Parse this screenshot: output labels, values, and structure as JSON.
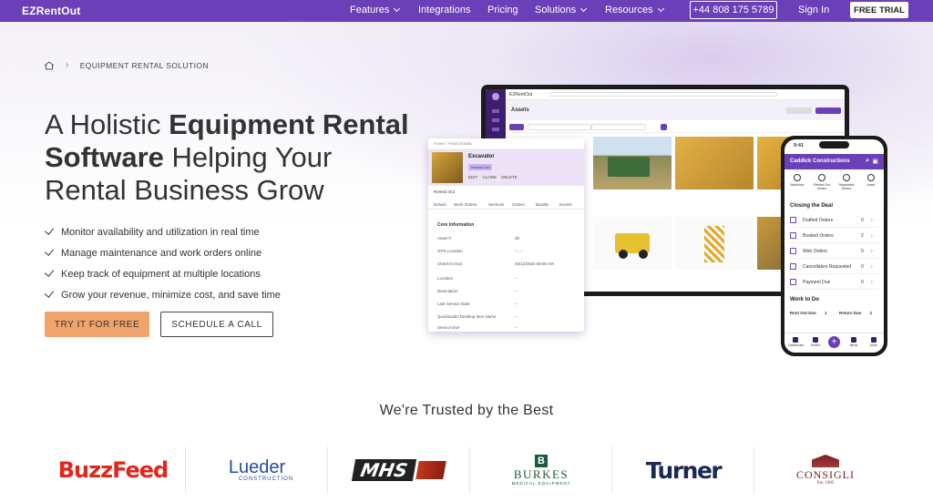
{
  "nav": {
    "brand": "EZRentOut",
    "items": [
      {
        "label": "Features",
        "dropdown": true
      },
      {
        "label": "Integrations",
        "dropdown": false
      },
      {
        "label": "Pricing",
        "dropdown": false
      },
      {
        "label": "Solutions",
        "dropdown": true
      },
      {
        "label": "Resources",
        "dropdown": true
      }
    ],
    "phone": "+44 808 175 5789",
    "signin": "Sign In",
    "trial": "FREE TRIAL"
  },
  "breadcrumb": {
    "current": "EQUIPMENT RENTAL SOLUTION"
  },
  "hero": {
    "title_parts": [
      "A Holistic ",
      "Equipment Rental Software",
      " Helping Your Rental Business Grow"
    ],
    "bullets": [
      "Monitor availability and utilization in real time",
      "Manage maintenance and work orders online",
      "Keep track of equipment at multiple locations",
      "Grow your revenue, minimize cost, and save time"
    ],
    "cta_primary": "TRY IT FOR FREE",
    "cta_secondary": "SCHEDULE A CALL"
  },
  "laptop": {
    "app_name": "EZRentOut",
    "page_title": "Assets"
  },
  "detail_card": {
    "breadcrumb": "Home / Asset Details",
    "title": "Excavator",
    "badge": "Rented Out",
    "actions": [
      "EDIT",
      "CLONE",
      "DELETE"
    ],
    "rented_line": "Rented Out",
    "tabs": [
      "Details",
      "Work Orders",
      "Services",
      "Orders",
      "Bundle",
      "Events"
    ],
    "section": "Core Information",
    "rows": [
      {
        "label": "Asset #",
        "value": "35"
      },
      {
        "label": "GPS Location",
        "value": "--, --"
      },
      {
        "label": "Check-In Due",
        "value": "03/12/2024   09:00 AM"
      },
      {
        "label": "Location",
        "value": "--"
      },
      {
        "label": "Description",
        "value": "--"
      },
      {
        "label": "Last Service Date",
        "value": "--"
      },
      {
        "label": "Quickbooks Desktop Item Name",
        "value": "--"
      },
      {
        "label": "Service Due",
        "value": "--"
      }
    ]
  },
  "phone": {
    "time": "9:41",
    "company": "Caddick Constructions",
    "quick_icons": [
      "Machines",
      "Rented Out Orders",
      "Requested Orders",
      "Asset"
    ],
    "section1": "Closing the Deal",
    "rows": [
      {
        "label": "Drafted Orders",
        "count": "0"
      },
      {
        "label": "Booked Orders",
        "count": "2"
      },
      {
        "label": "Web Orders",
        "count": "0"
      },
      {
        "label": "Cancellation Requested",
        "count": "0"
      },
      {
        "label": "Payment Due",
        "count": "0"
      }
    ],
    "section2": "Work to Do",
    "work": [
      {
        "label": "Rent Out Due",
        "count": "1"
      },
      {
        "label": "Return Due",
        "count": "2"
      }
    ],
    "bottom_nav": [
      "Dashboard",
      "Orders",
      "Items",
      "More"
    ]
  },
  "trusted": {
    "heading": "We're Trusted by the Best",
    "logos": [
      {
        "name": "BuzzFeed",
        "color": "#e32619"
      },
      {
        "name": "Lueder",
        "sub": "CONSTRUCTION",
        "color": "#1f4e9e"
      },
      {
        "name": "MHS",
        "color": "#222222"
      },
      {
        "name": "BURKES",
        "sub": "MEDICAL EQUIPMENT",
        "color": "#1c5a3a"
      },
      {
        "name": "Turner",
        "color": "#1b2a55"
      },
      {
        "name": "CONSIGLI",
        "sub": "Est. 1905",
        "color": "#7a1f1f"
      }
    ]
  },
  "colors": {
    "brand_purple": "#6a3fb8",
    "cta_orange": "#f0a36b"
  }
}
